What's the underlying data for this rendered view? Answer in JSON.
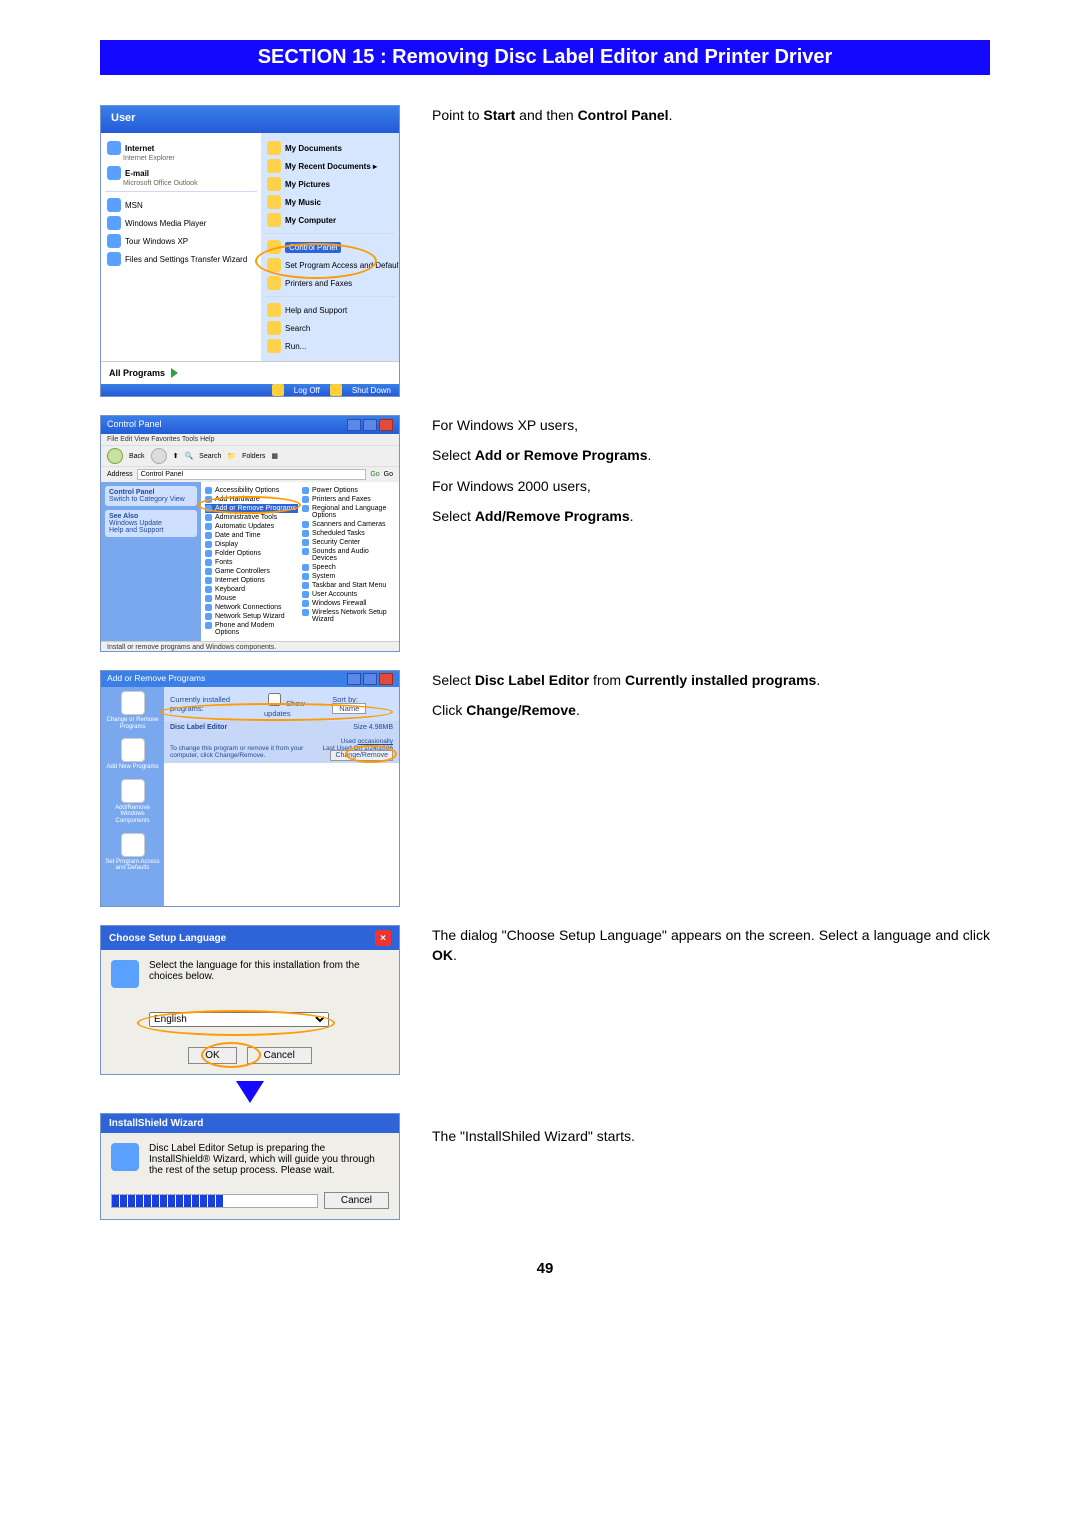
{
  "section_title": "SECTION 15 : Removing Disc Label Editor and Printer Driver",
  "page_number": "49",
  "step1": {
    "line1_a": "Point to ",
    "line1_b": "Start",
    "line1_c": " and then ",
    "line1_d": "Control Panel",
    "line1_e": "."
  },
  "step2": {
    "xp_intro": "For Windows XP users,",
    "xp_select_a": "Select ",
    "xp_select_b": "Add or Remove Programs",
    "xp_select_c": ".",
    "w2k_intro": "For Windows 2000 users,",
    "w2k_select_a": "Select ",
    "w2k_select_b": "Add/Remove Programs",
    "w2k_select_c": "."
  },
  "step3": {
    "a": "Select ",
    "b": "Disc Label Editor",
    "c": " from ",
    "d": "Currently installed programs",
    "e": ".",
    "f": "Click ",
    "g": "Change/Remove",
    "h": "."
  },
  "step4": {
    "a": "The dialog \"Choose Setup Language\" appears on the screen. Select a language and click ",
    "b": "OK",
    "c": "."
  },
  "step5": {
    "a": "The \"InstallShiled Wizard\" starts."
  },
  "startmenu": {
    "user": "User",
    "left": {
      "internet": "Internet",
      "internet_sub": "Internet Explorer",
      "email": "E-mail",
      "email_sub": "Microsoft Office Outlook",
      "msn": "MSN",
      "wmp": "Windows Media Player",
      "tour": "Tour Windows XP",
      "fst": "Files and Settings Transfer Wizard",
      "all": "All Programs"
    },
    "right": {
      "docs": "My Documents",
      "recent": "My Recent Documents  ▸",
      "pics": "My Pictures",
      "music": "My Music",
      "comp": "My Computer",
      "cp": "Control Panel",
      "spa": "Set Program Access and Defaults",
      "pf": "Printers and Faxes",
      "help": "Help and Support",
      "search": "Search",
      "run": "Run..."
    },
    "logoff": "Log Off",
    "shutdown": "Shut Down"
  },
  "cp": {
    "title": "Control Panel",
    "menu": "File   Edit   View   Favorites   Tools   Help",
    "back": "Back",
    "search": "Search",
    "folders": "Folders",
    "addr_label": "Address",
    "addr_value": "Control Panel",
    "go": "Go",
    "side_title": "Control Panel",
    "side_switch": "Switch to Category View",
    "side_see": "See Also",
    "side_wu": "Windows Update",
    "side_hs": "Help and Support",
    "status": "Install or remove programs and Windows components.",
    "icons": [
      "Accessibility Options",
      "Add Hardware",
      "Add or Remove Programs",
      "Administrative Tools",
      "Automatic Updates",
      "Date and Time",
      "Display",
      "Folder Options",
      "Fonts",
      "Game Controllers",
      "Internet Options",
      "Keyboard",
      "Mouse",
      "Network Connections",
      "Network Setup Wizard",
      "Phone and Modem Options",
      "Power Options",
      "Printers and Faxes",
      "Regional and Language Options",
      "Scanners and Cameras",
      "Scheduled Tasks",
      "Security Center",
      "Sounds and Audio Devices",
      "Speech",
      "System",
      "Taskbar and Start Menu",
      "User Accounts",
      "Windows Firewall",
      "Wireless Network Setup Wizard"
    ],
    "selected_index": 2
  },
  "arp": {
    "title": "Add or Remove Programs",
    "side": [
      "Change or Remove Programs",
      "Add New Programs",
      "Add/Remove Windows Components",
      "Set Program Access and Defaults"
    ],
    "head_label": "Currently installed programs:",
    "show_updates": "Show updates",
    "sort_label": "Sort by:",
    "sort_value": "Name",
    "program": "Disc Label Editor",
    "size_label": "Size",
    "size_value": "4.98MB",
    "used_label": "Used",
    "used_value": "occasionally",
    "last_label": "Last Used On",
    "last_value": "1/24/2006",
    "hint": "To change this program or remove it from your computer, click Change/Remove.",
    "btn": "Change/Remove"
  },
  "lang": {
    "title": "Choose Setup Language",
    "msg": "Select the language for this installation from the choices below.",
    "value": "English",
    "ok": "OK",
    "cancel": "Cancel"
  },
  "ish": {
    "title": "InstallShield Wizard",
    "msg": "Disc Label Editor Setup is preparing the InstallShield® Wizard, which will guide you through the rest of the setup process. Please wait.",
    "cancel": "Cancel"
  }
}
